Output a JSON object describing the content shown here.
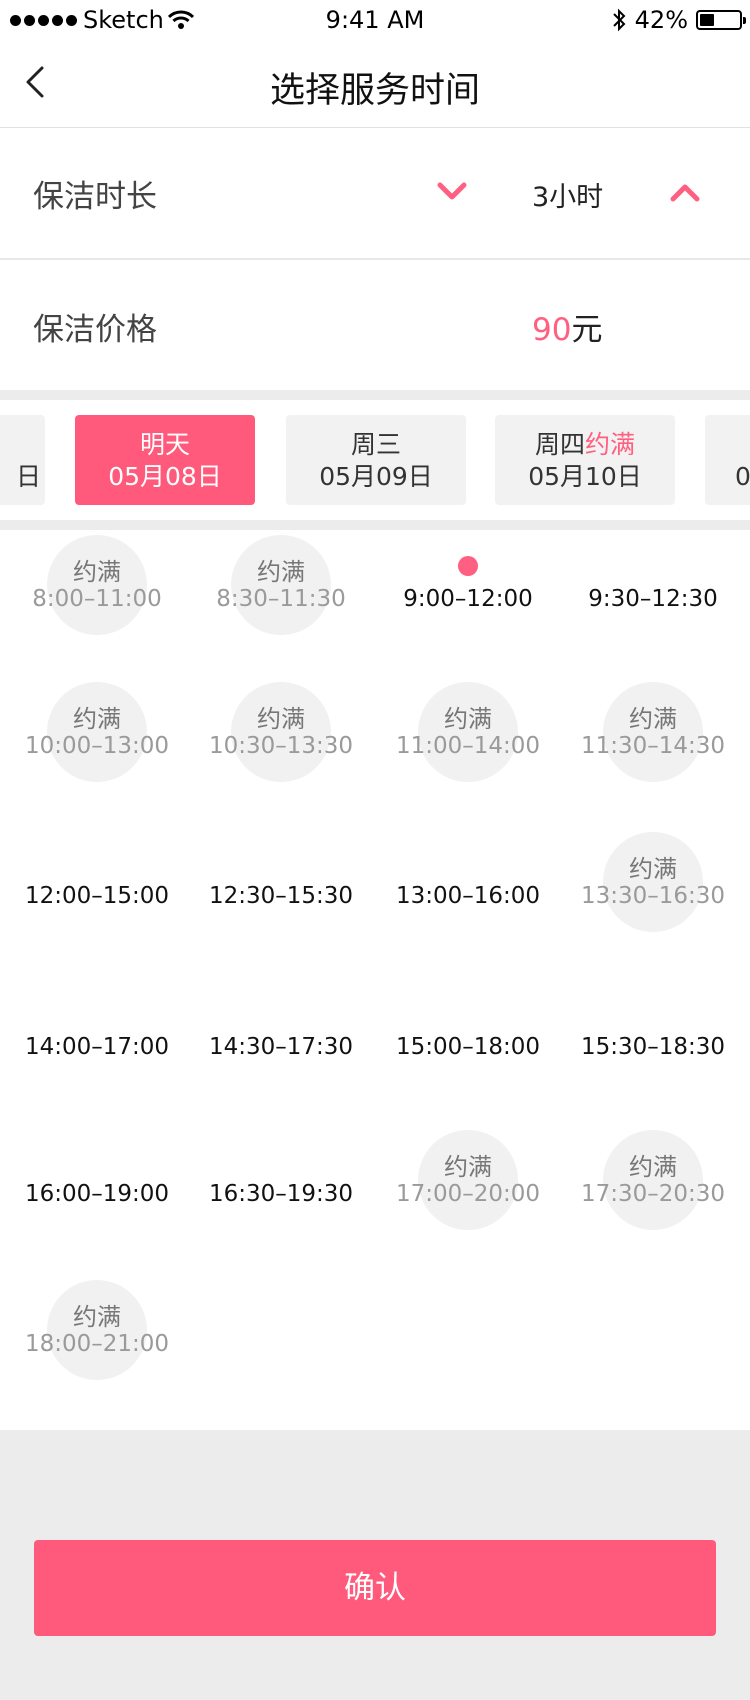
{
  "status_bar": {
    "carrier": "Sketch",
    "time": "9:41 AM",
    "battery_percent": "42%",
    "battery_level": 0.42
  },
  "nav": {
    "title": "选择服务时间"
  },
  "options": {
    "duration_label": "保洁时长",
    "duration_value": "3小时",
    "price_label": "保洁价格",
    "price_amount": "90",
    "price_unit": "元"
  },
  "dates": [
    {
      "line1": "",
      "line1_full": "",
      "line2": "日"
    },
    {
      "line1": "明天",
      "line1_full": "",
      "line2": "05月08日",
      "selected": true
    },
    {
      "line1": "周三",
      "line1_full": "",
      "line2": "05月09日"
    },
    {
      "line1": "周四",
      "line1_full": "约满",
      "line2": "05月10日"
    },
    {
      "line1": "",
      "line1_full": "",
      "line2": "0"
    }
  ],
  "full_text": "约满",
  "slots": [
    {
      "time": "8:00–11:00",
      "status": "full"
    },
    {
      "time": "8:30–11:30",
      "status": "full"
    },
    {
      "time": "9:00–12:00",
      "status": "selected"
    },
    {
      "time": "9:30–12:30",
      "status": "available"
    },
    {
      "time": "10:00–13:00",
      "status": "full"
    },
    {
      "time": "10:30–13:30",
      "status": "full"
    },
    {
      "time": "11:00–14:00",
      "status": "full"
    },
    {
      "time": "11:30–14:30",
      "status": "full"
    },
    {
      "time": "12:00–15:00",
      "status": "available"
    },
    {
      "time": "12:30–15:30",
      "status": "available"
    },
    {
      "time": "13:00–16:00",
      "status": "available"
    },
    {
      "time": "13:30–16:30",
      "status": "full"
    },
    {
      "time": "14:00–17:00",
      "status": "available"
    },
    {
      "time": "14:30–17:30",
      "status": "available"
    },
    {
      "time": "15:00–18:00",
      "status": "available"
    },
    {
      "time": "15:30–18:30",
      "status": "available"
    },
    {
      "time": "16:00–19:00",
      "status": "available"
    },
    {
      "time": "16:30–19:30",
      "status": "available"
    },
    {
      "time": "17:00–20:00",
      "status": "full"
    },
    {
      "time": "17:30–20:30",
      "status": "full"
    },
    {
      "time": "18:00–21:00",
      "status": "full"
    }
  ],
  "confirm_label": "确认",
  "colors": {
    "accent": "#ff5a7c",
    "background_gray": "#ececec",
    "full_circle": "#f1f1f1"
  }
}
